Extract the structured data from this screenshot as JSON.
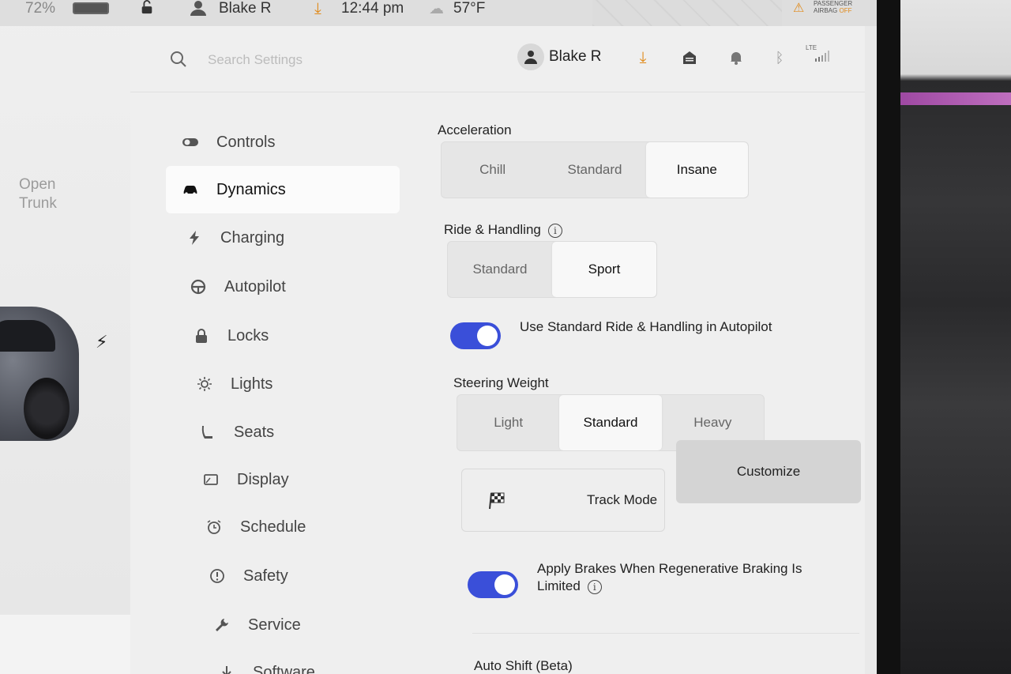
{
  "status_bar": {
    "battery_percent": "72%",
    "user": "Blake R",
    "time": "12:44 pm",
    "temperature": "57°F",
    "airbag_line1": "PASSENGER",
    "airbag_line2": "AIRBAG",
    "airbag_state": "OFF"
  },
  "car_pane": {
    "trunk_label": "Open\nTrunk"
  },
  "header": {
    "search_placeholder": "Search Settings",
    "user": "Blake R",
    "lte_label": "LTE"
  },
  "nav": {
    "items": [
      {
        "label": "Controls",
        "icon": "toggle-icon",
        "active": false
      },
      {
        "label": "Dynamics",
        "icon": "car-icon",
        "active": true
      },
      {
        "label": "Charging",
        "icon": "bolt-icon",
        "active": false
      },
      {
        "label": "Autopilot",
        "icon": "steering-wheel-icon",
        "active": false
      },
      {
        "label": "Locks",
        "icon": "lock-icon",
        "active": false
      },
      {
        "label": "Lights",
        "icon": "sun-icon",
        "active": false
      },
      {
        "label": "Seats",
        "icon": "seat-icon",
        "active": false
      },
      {
        "label": "Display",
        "icon": "display-icon",
        "active": false
      },
      {
        "label": "Schedule",
        "icon": "alarm-clock-icon",
        "active": false
      },
      {
        "label": "Safety",
        "icon": "alert-circle-icon",
        "active": false
      },
      {
        "label": "Service",
        "icon": "wrench-icon",
        "active": false
      },
      {
        "label": "Software",
        "icon": "download-icon",
        "active": false
      }
    ]
  },
  "dynamics": {
    "acceleration": {
      "label": "Acceleration",
      "options": [
        "Chill",
        "Standard",
        "Insane"
      ],
      "selected": "Insane"
    },
    "ride_handling": {
      "label": "Ride & Handling",
      "options": [
        "Standard",
        "Sport"
      ],
      "selected": "Sport"
    },
    "standard_ride_autopilot": {
      "label": "Use Standard Ride & Handling in Autopilot",
      "enabled": true
    },
    "steering_weight": {
      "label": "Steering Weight",
      "options": [
        "Light",
        "Standard",
        "Heavy"
      ],
      "selected": "Standard"
    },
    "track_mode": {
      "label": "Track Mode",
      "customize_label": "Customize"
    },
    "apply_brakes": {
      "label": "Apply Brakes When Regenerative Braking Is Limited",
      "enabled": true
    },
    "auto_shift": {
      "label": "Auto Shift (Beta)"
    }
  },
  "colors": {
    "toggle_on": "#3a4fd9",
    "accent_orange": "#e08a1a"
  }
}
